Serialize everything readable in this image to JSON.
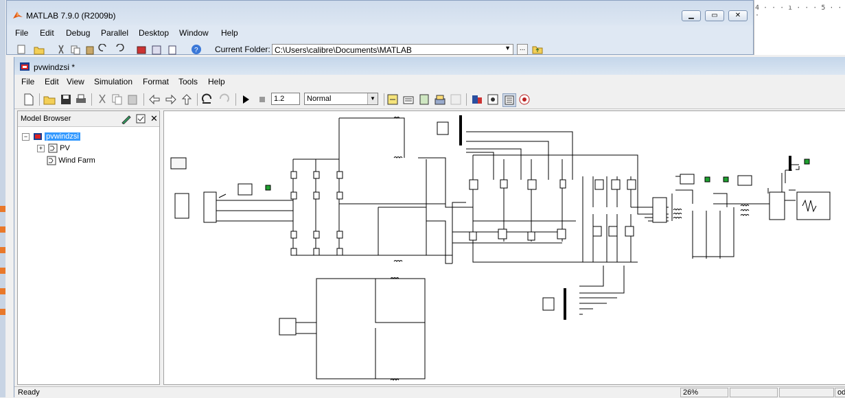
{
  "matlab_window": {
    "title": "MATLAB  7.9.0 (R2009b)",
    "menu": [
      "File",
      "Edit",
      "Debug",
      "Parallel",
      "Desktop",
      "Window",
      "Help"
    ],
    "current_folder_label": "Current Folder:",
    "current_folder_value": "C:\\Users\\calibre\\Documents\\MATLAB",
    "browse_label": "..."
  },
  "ruler": {
    "text": "4 · · · ı · · · 5 · · ·"
  },
  "model_window": {
    "title": "pvwindzsi *",
    "menu": [
      "File",
      "Edit",
      "View",
      "Simulation",
      "Format",
      "Tools",
      "Help"
    ],
    "stop_time": "1.2",
    "sim_mode": "Normal"
  },
  "model_browser": {
    "title": "Model Browser",
    "items": [
      {
        "label": "pvwindzsi",
        "selected": true
      },
      {
        "label": "PV"
      },
      {
        "label": "Wind Farm"
      }
    ]
  },
  "status_bar": {
    "state": "Ready",
    "zoom": "26%",
    "solver": "od"
  },
  "colors": {
    "title_bar": "#cfdcec",
    "selection": "#3399ff",
    "canvas": "#ffffff",
    "scope_green": "#1fa030"
  }
}
